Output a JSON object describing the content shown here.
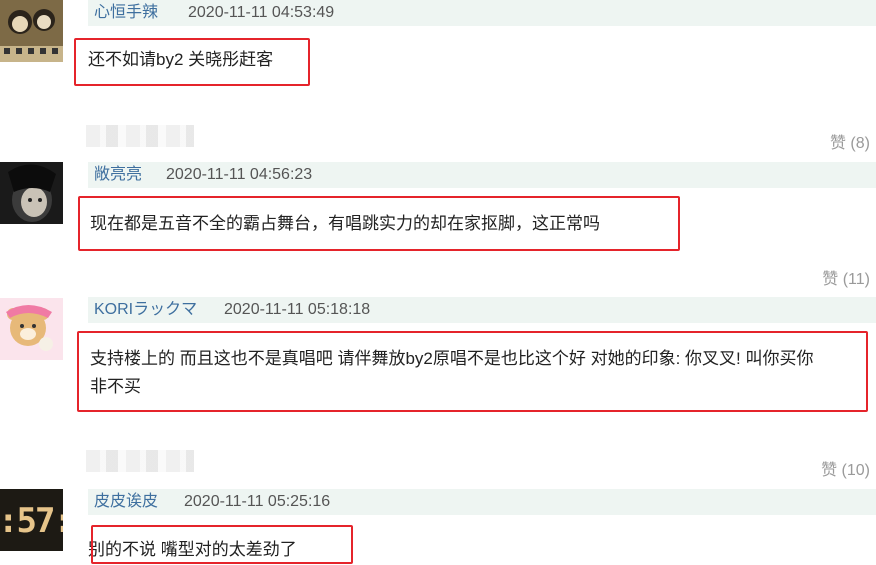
{
  "comments": [
    {
      "user": "心恒手辣",
      "time": "2020-11-11 04:53:49",
      "text": "还不如请by2 关晓彤赶客",
      "likes": "赞 (8)"
    },
    {
      "user": "敞亮亮",
      "time": "2020-11-11 04:56:23",
      "text": "现在都是五音不全的霸占舞台，有唱跳实力的却在家抠脚，这正常吗",
      "likes": "赞 (11)"
    },
    {
      "user": "KORIラックマ",
      "time": "2020-11-11 05:18:18",
      "text_line1": "支持楼上的 而且这也不是真唱吧 请伴舞放by2原唱不是也比这个好 对她的印象: 你叉叉! 叫你买你",
      "text_line2": "非不买",
      "likes": "赞 (10)"
    },
    {
      "user": "皮皮诶皮",
      "time": "2020-11-11 05:25:16",
      "text": "别的不说 嘴型对的太差劲了",
      "avatar_clock": ":57:"
    }
  ],
  "colors": {
    "highlight": "#e5242b",
    "username": "#3e6f9f",
    "meta_bg": "#eef5f2"
  }
}
